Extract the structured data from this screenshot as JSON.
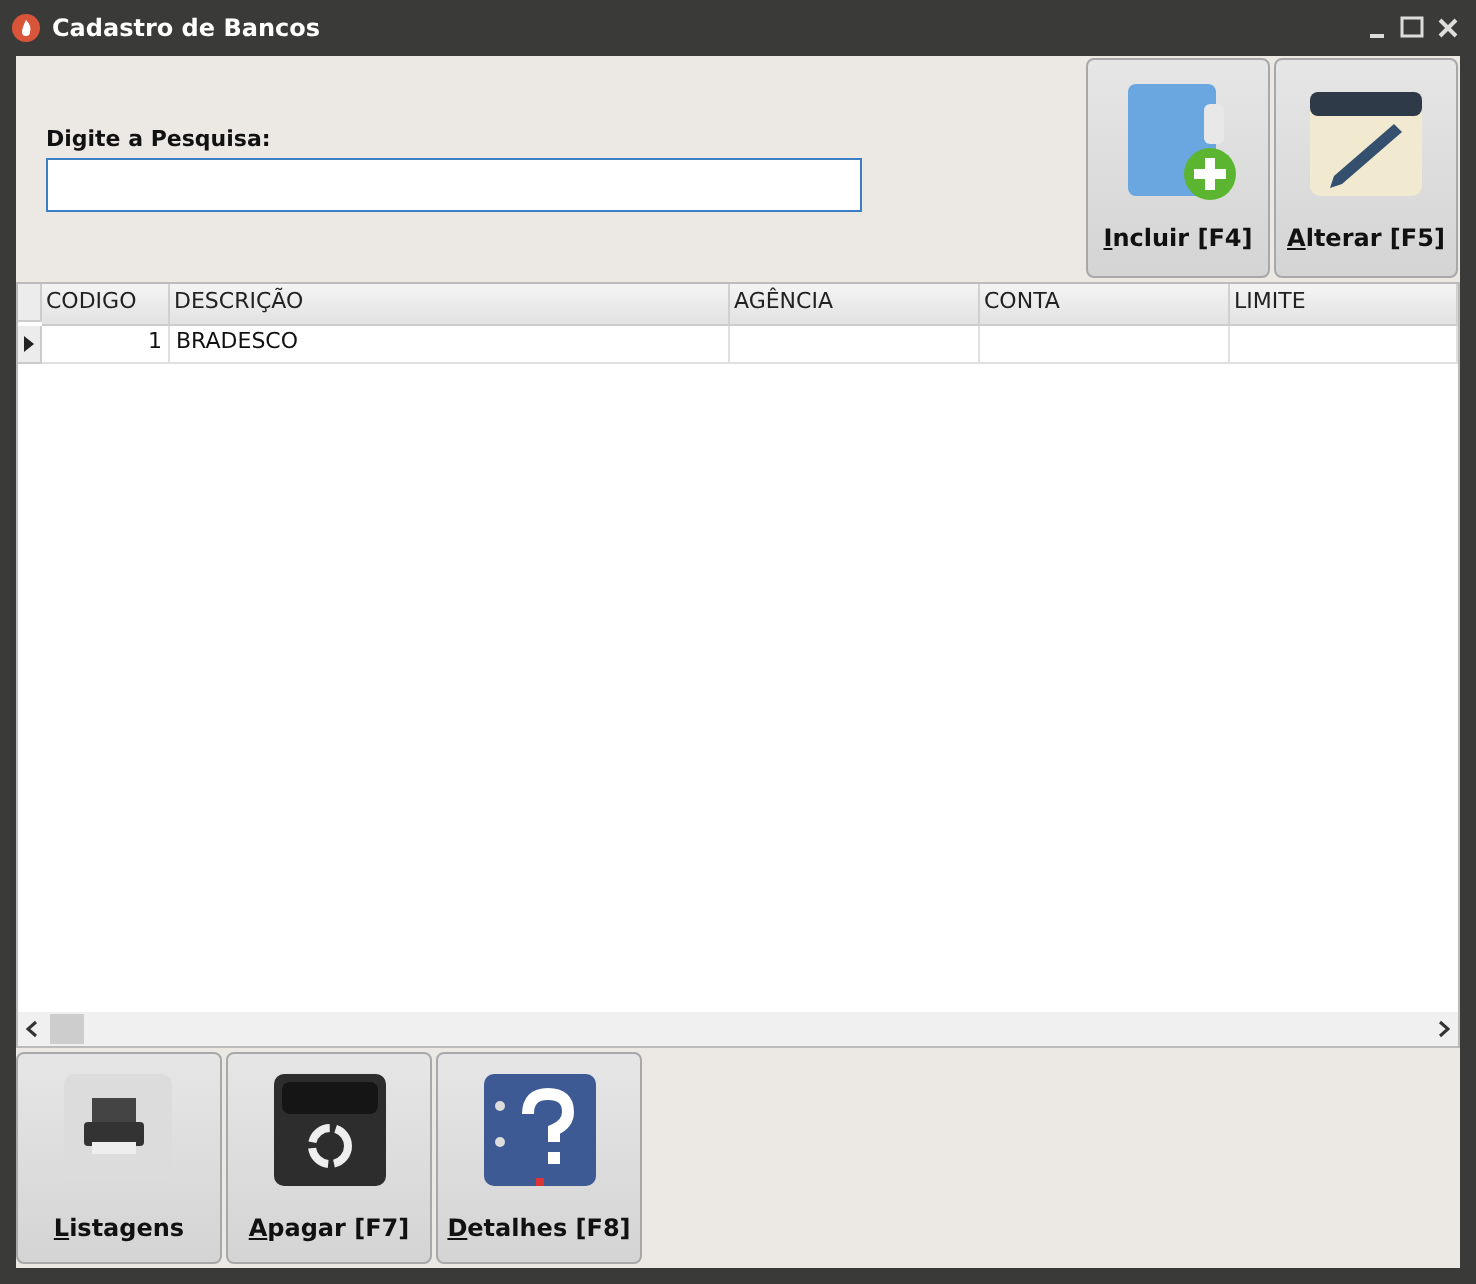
{
  "window": {
    "title": "Cadastro de Bancos"
  },
  "search": {
    "label": "Digite a Pesquisa:",
    "focused": true
  },
  "top_buttons": [
    {
      "kind": "add",
      "label": "Incluir [F4]"
    },
    {
      "kind": "edit",
      "label": "Alterar [F5]"
    }
  ],
  "table": {
    "columns": [
      "CODIGO",
      "DESCRIÇÃO",
      "AGÊNCIA",
      "CONTA",
      "LIMITE"
    ],
    "rows": [
      {
        "codigo": "1",
        "descricao": "BRADESCO",
        "current": true
      }
    ]
  },
  "bottom_buttons": [
    {
      "kind": "print",
      "label": "Listagens"
    },
    {
      "kind": "delete",
      "label": "Apagar [F7]"
    },
    {
      "kind": "help",
      "label": "Detalhes [F8]"
    }
  ]
}
